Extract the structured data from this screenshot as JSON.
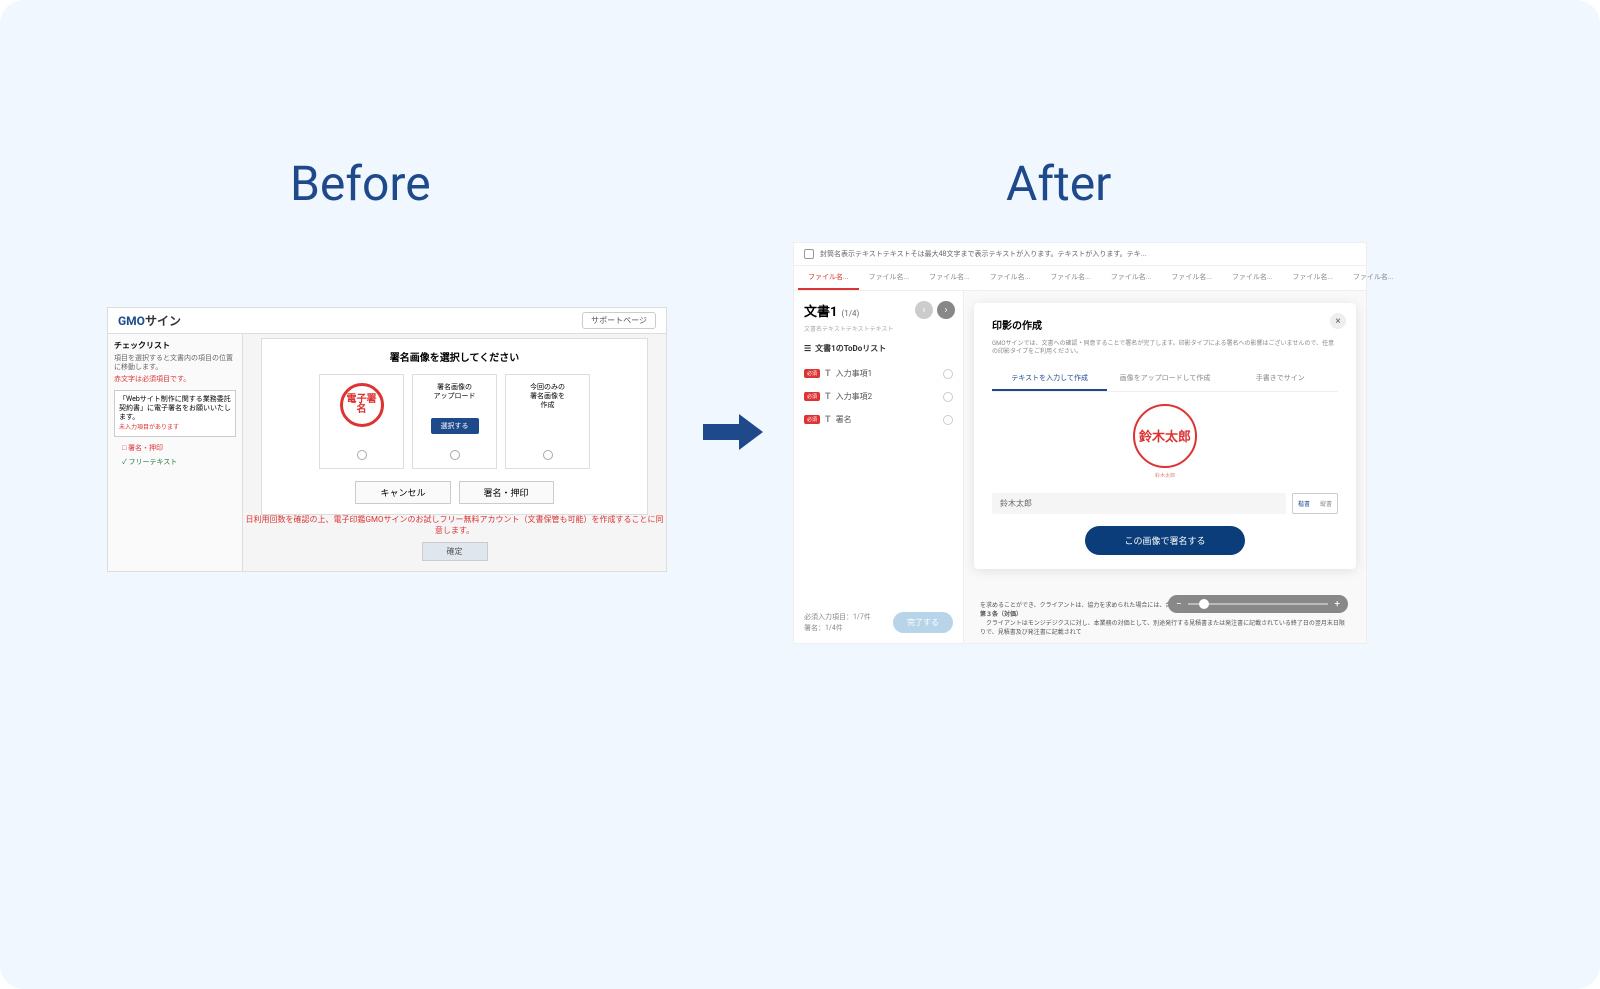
{
  "headings": {
    "before": "Before",
    "after": "After"
  },
  "before": {
    "logo_gmo": "GMO",
    "logo_sign": "サイン",
    "support": "サポートページ",
    "checklist": {
      "title": "チェックリスト",
      "desc": "項目を選択すると文書内の項目の位置に移動します。",
      "note": "赤文字は必須項目です。",
      "box_text": "「Webサイト制作に関する業務委託契約書」に電子署名をお願いいたします。",
      "box_note": "未入力項目があります",
      "item1": "□ 署名・押印",
      "item2": "✓ フリーテキスト"
    },
    "modal": {
      "title": "署名画像を選択してください",
      "hanko_text": "電子署名",
      "opt2_line1": "署名画像の",
      "opt2_line2": "アップロード",
      "opt2_btn": "選択する",
      "opt3_line1": "今回のみの",
      "opt3_line2": "署名画像を",
      "opt3_line3": "作成",
      "cancel": "キャンセル",
      "sign": "署名・押印"
    },
    "footer": {
      "text": "日利用回数を確認の上、電子印鑑GMOサインのお試しフリー無料アカウント（文書保管も可能）を作成することに同意します。",
      "confirm": "確定"
    }
  },
  "after": {
    "top_text": "封筒名表示テキストテキストそは最大48文字まで表示テキストが入ります。テキストが入ります。テキ...",
    "tab": "ファイル名...",
    "sidebar": {
      "doc_title": "文書1",
      "doc_count": "(1/4)",
      "doc_sub": "文書名テキストテキストテキスト",
      "todo_title": "文書1のToDoリスト",
      "badge": "必須",
      "item1": "入力事項1",
      "item2": "入力事項2",
      "item3": "署名",
      "stats1": "必須入力項目：1/7件",
      "stats2": "署名：1/4件",
      "complete": "完了する"
    },
    "modal": {
      "title": "印影の作成",
      "desc": "GMOサインでは、文書への確認・同意することで署名が完了します。印影タイプによる署名への影響はございませんので、任意の印影タイプをご利用ください。",
      "tab1": "テキストを入力して作成",
      "tab2": "画像をアップロードして作成",
      "tab3": "手書きでサイン",
      "hanko_name": "鈴木太郎",
      "input_value": "鈴木太郎",
      "style1": "楷書",
      "style2": "縦書",
      "sign_btn": "この画像で署名する"
    },
    "doc_bg": {
      "line1": "を求めることができ、クライアントは、協力を求められた場合には、合理的な範囲において速やかに協力するものとする。",
      "line2": "第３条（対価）",
      "line3": "　クライアントはモンジデジクスに対し、本業務の対価として、別途発行する見積書または発注書に記載されている終了日の翌月末日限りで、見積書及び発注書に記載されて"
    }
  }
}
